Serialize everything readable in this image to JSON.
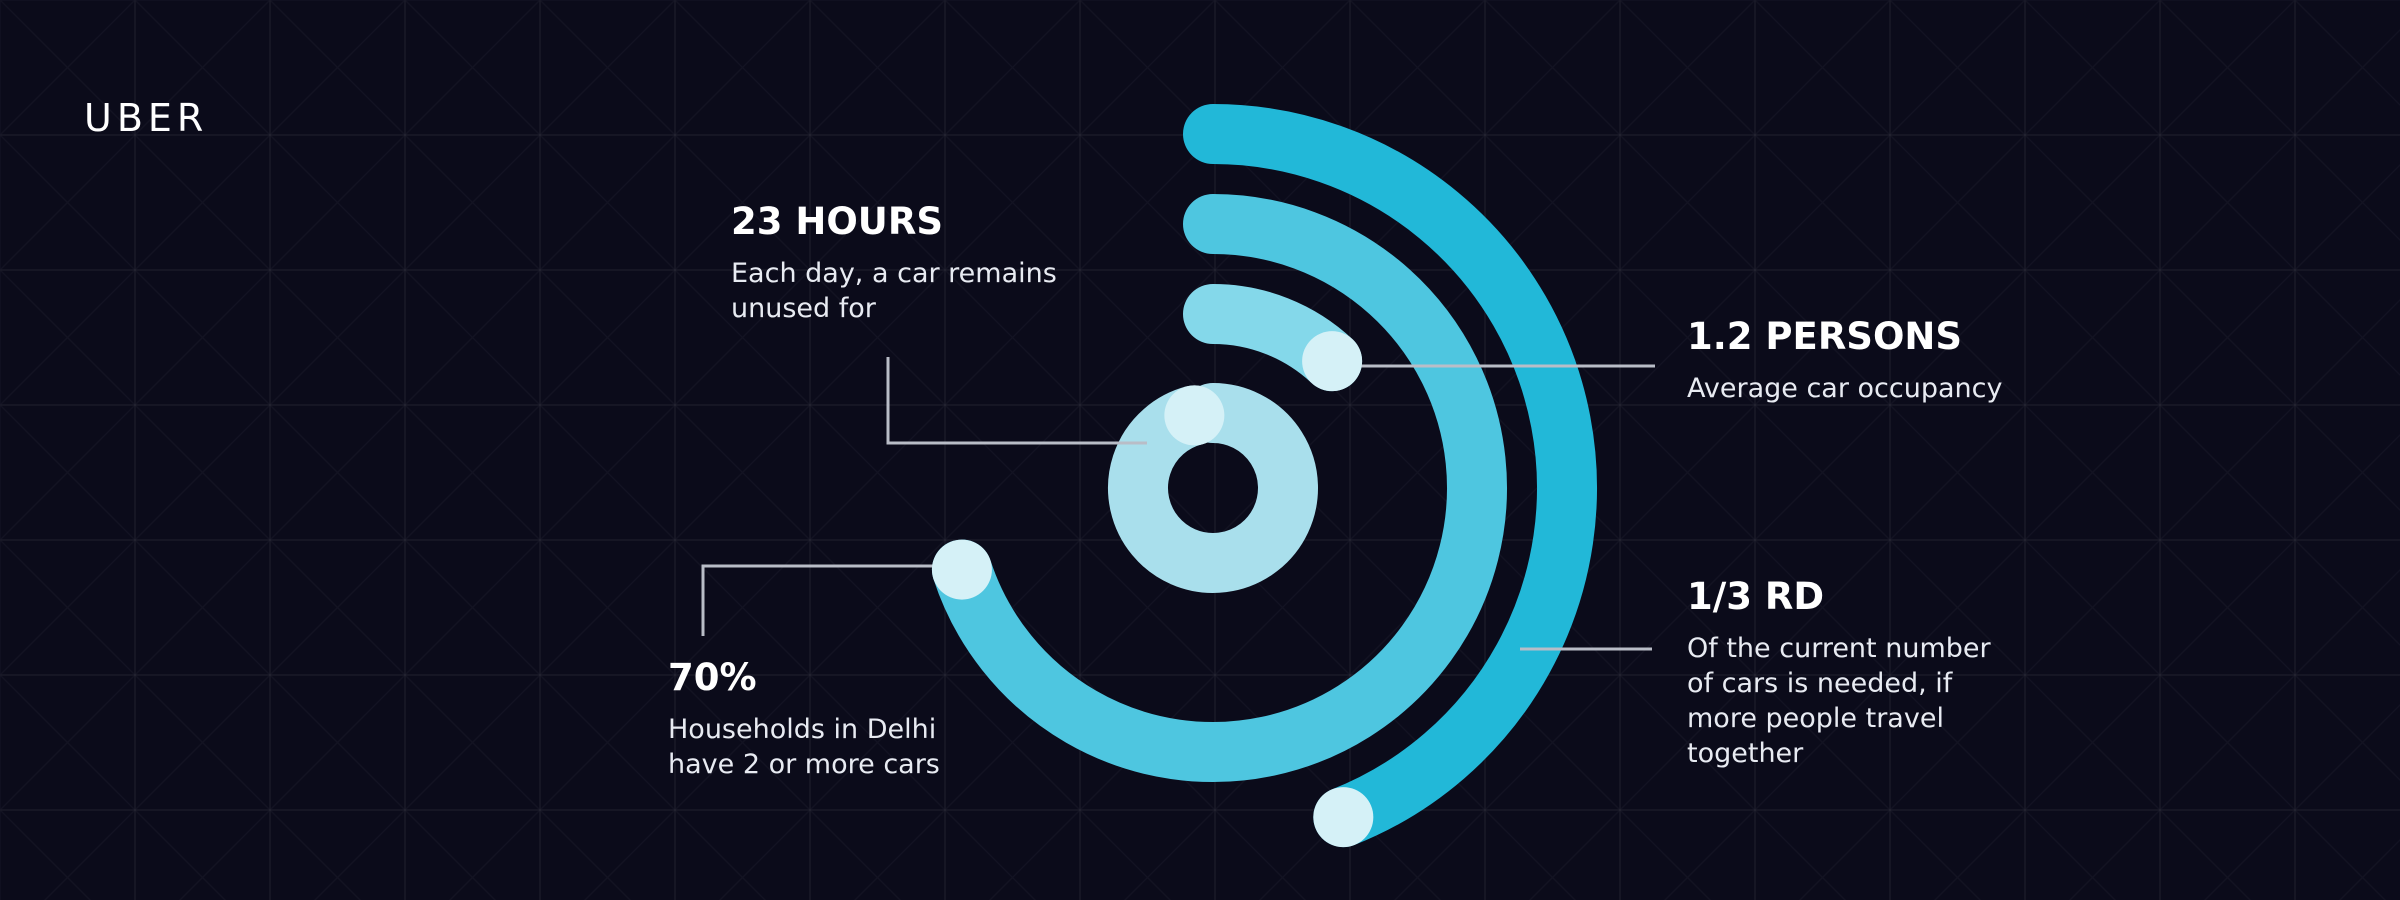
{
  "brand": {
    "logo": "UBER"
  },
  "colors": {
    "background": "#0b0b1a",
    "ring_outer": "#22b8d8",
    "ring_second": "#4ec6e0",
    "ring_third": "#84d8ea",
    "ring_inner": "#a9dfec",
    "marker": "#d5f1f7",
    "leader_line": "#b9bdc7"
  },
  "callouts": {
    "hours": {
      "title": "23 HOURS",
      "desc": "Each day, a car remains\nunused for"
    },
    "persons": {
      "title": "1.2 PERSONS",
      "desc": "Average car occupancy"
    },
    "households": {
      "title": "70%",
      "desc": "Households in Delhi\nhave 2 or more cars"
    },
    "rd": {
      "title": "1/3 RD",
      "desc": "Of the current number\nof cars is needed, if\nmore people travel\ntogether"
    }
  },
  "chart_data": {
    "type": "radial-bar",
    "title": "",
    "series": [
      {
        "label": "1/3 RD",
        "ring": "outer",
        "sweep_fraction": 0.44
      },
      {
        "label": "70%",
        "ring": "second",
        "sweep_fraction": 0.7
      },
      {
        "label": "1.2 PERSONS",
        "ring": "third",
        "sweep_fraction": 0.12
      },
      {
        "label": "23 HOURS",
        "ring": "inner",
        "sweep_fraction": 0.96
      }
    ]
  }
}
